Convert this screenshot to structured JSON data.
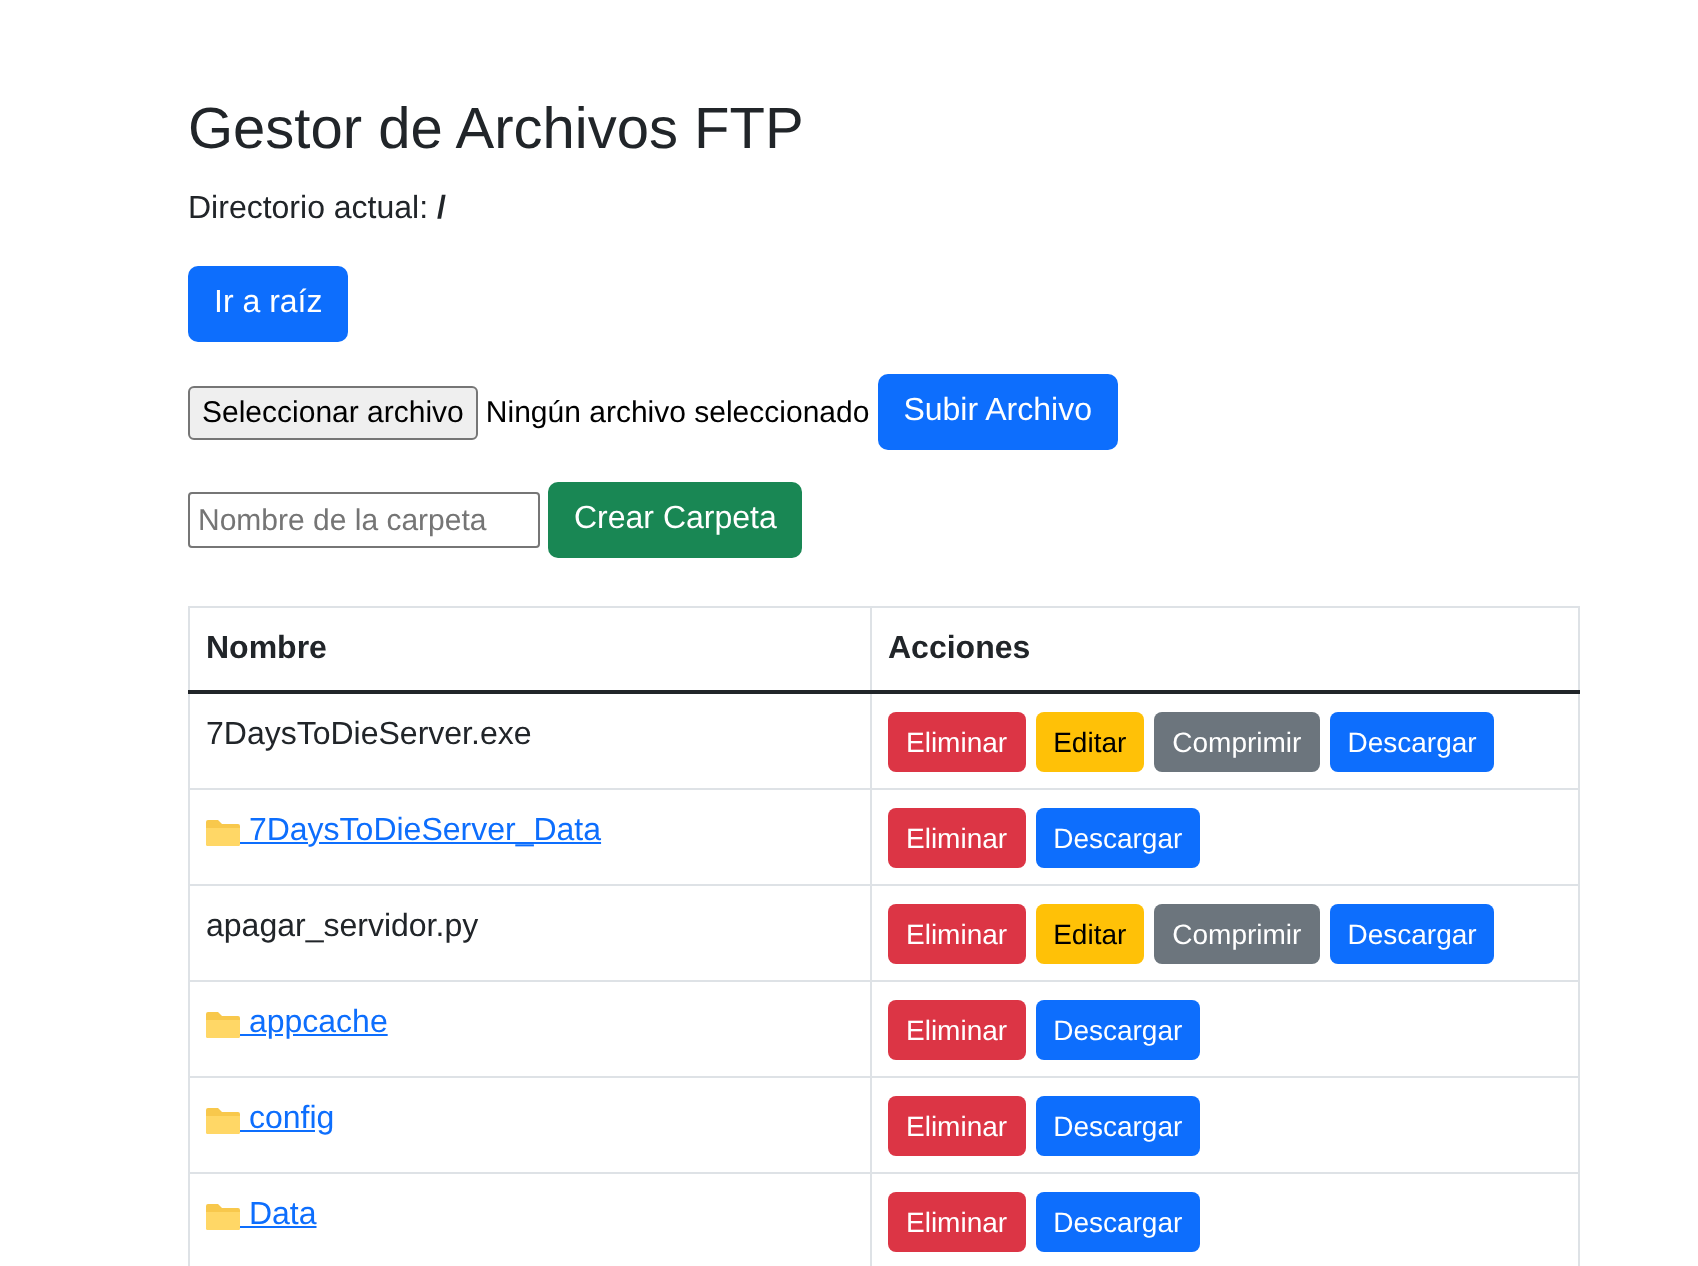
{
  "title": "Gestor de Archivos FTP",
  "current_dir": {
    "label": "Directorio actual:",
    "path": "/"
  },
  "root_button": "Ir a raíz",
  "upload": {
    "choose_button": "Seleccionar archivo",
    "status": "Ningún archivo seleccionado",
    "submit": "Subir Archivo"
  },
  "create_folder": {
    "placeholder": "Nombre de la carpeta",
    "submit": "Crear Carpeta"
  },
  "table": {
    "columns": [
      "Nombre",
      "Acciones"
    ],
    "rows": [
      {
        "kind": "file",
        "name": "7DaysToDieServer.exe",
        "actions": [
          {
            "kind": "delete",
            "label": "Eliminar"
          },
          {
            "kind": "edit",
            "label": "Editar"
          },
          {
            "kind": "compress",
            "label": "Comprimir"
          },
          {
            "kind": "download",
            "label": "Descargar"
          }
        ]
      },
      {
        "kind": "folder",
        "name": " 7DaysToDieServer_Data",
        "actions": [
          {
            "kind": "delete",
            "label": "Eliminar"
          },
          {
            "kind": "download",
            "label": "Descargar"
          }
        ]
      },
      {
        "kind": "file",
        "name": "apagar_servidor.py",
        "actions": [
          {
            "kind": "delete",
            "label": "Eliminar"
          },
          {
            "kind": "edit",
            "label": "Editar"
          },
          {
            "kind": "compress",
            "label": "Comprimir"
          },
          {
            "kind": "download",
            "label": "Descargar"
          }
        ]
      },
      {
        "kind": "folder",
        "name": " appcache",
        "actions": [
          {
            "kind": "delete",
            "label": "Eliminar"
          },
          {
            "kind": "download",
            "label": "Descargar"
          }
        ]
      },
      {
        "kind": "folder",
        "name": " config",
        "actions": [
          {
            "kind": "delete",
            "label": "Eliminar"
          },
          {
            "kind": "download",
            "label": "Descargar"
          }
        ]
      },
      {
        "kind": "folder",
        "name": " Data",
        "actions": [
          {
            "kind": "delete",
            "label": "Eliminar"
          },
          {
            "kind": "download",
            "label": "Descargar"
          }
        ]
      }
    ]
  }
}
